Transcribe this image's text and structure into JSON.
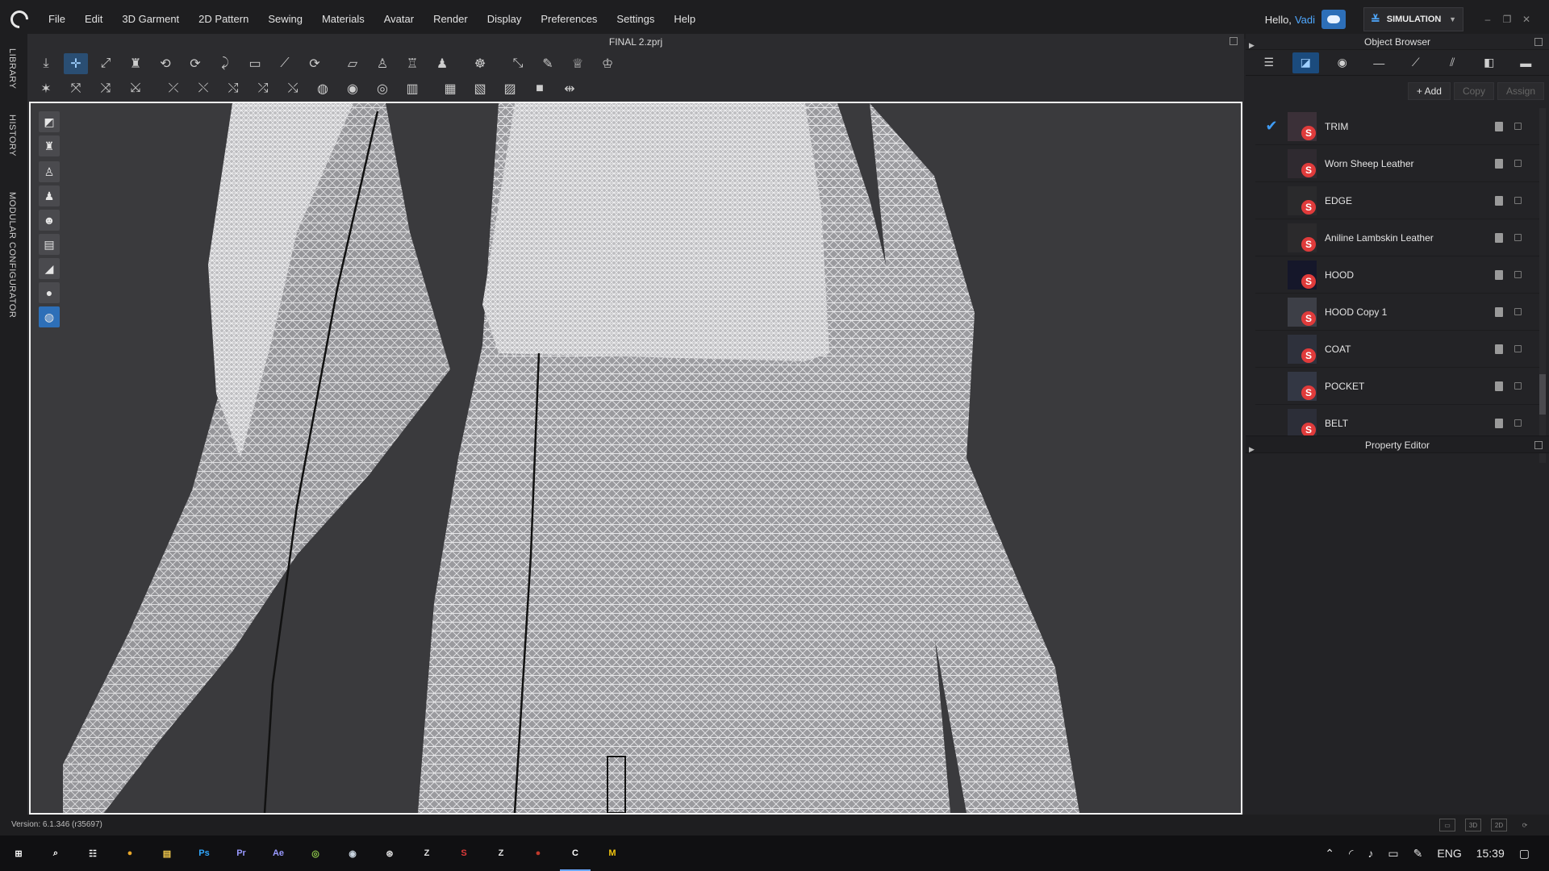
{
  "menu": [
    "File",
    "Edit",
    "3D Garment",
    "2D Pattern",
    "Sewing",
    "Materials",
    "Avatar",
    "Render",
    "Display",
    "Preferences",
    "Settings",
    "Help"
  ],
  "greeting": "Hello,",
  "username": "Vadi",
  "mode": "SIMULATION",
  "left_tabs": [
    "LIBRARY",
    "HISTORY",
    "MODULAR CONFIGURATOR"
  ],
  "file_title": "FINAL 2.zprj",
  "object_browser": {
    "title": "Object Browser",
    "actions": {
      "add": "+ Add",
      "copy": "Copy",
      "assign": "Assign"
    },
    "materials": [
      {
        "name": "TRIM",
        "selected": true,
        "thumb": "#3b3038"
      },
      {
        "name": "Worn Sheep Leather",
        "selected": false,
        "thumb": "#2f2a30"
      },
      {
        "name": "EDGE",
        "selected": false,
        "thumb": "#2a2a2c"
      },
      {
        "name": "Aniline Lambskin Leather",
        "selected": false,
        "thumb": "#2b2a2c"
      },
      {
        "name": "HOOD",
        "selected": false,
        "thumb": "#15172a"
      },
      {
        "name": "HOOD Copy 1",
        "selected": false,
        "thumb": "#3d3f47"
      },
      {
        "name": "COAT",
        "selected": false,
        "thumb": "#2e313c"
      },
      {
        "name": "POCKET",
        "selected": false,
        "thumb": "#333744"
      },
      {
        "name": "BELT",
        "selected": false,
        "thumb": "#2c2e38"
      }
    ]
  },
  "property_editor": {
    "title": "Property Editor"
  },
  "status": {
    "version": "Version: 6.1.346 (r35697)"
  },
  "taskbar": {
    "apps": [
      {
        "label": "⊞",
        "color": "#ffffff"
      },
      {
        "label": "⌕",
        "color": "#ffffff"
      },
      {
        "label": "☷",
        "color": "#ffffff"
      },
      {
        "label": "●",
        "color": "#e8a72a"
      },
      {
        "label": "▤",
        "color": "#f2c94c"
      },
      {
        "label": "Ps",
        "color": "#31a8ff"
      },
      {
        "label": "Pr",
        "color": "#9999ff"
      },
      {
        "label": "Ae",
        "color": "#9999ff"
      },
      {
        "label": "◎",
        "color": "#8bc34a"
      },
      {
        "label": "◉",
        "color": "#c9d4e0"
      },
      {
        "label": "⊛",
        "color": "#e0e0e0"
      },
      {
        "label": "Z",
        "color": "#e0e0e0"
      },
      {
        "label": "S",
        "color": "#e03b3b"
      },
      {
        "label": "Z",
        "color": "#e0e0e0"
      },
      {
        "label": "●",
        "color": "#c0392b"
      },
      {
        "label": "C",
        "color": "#ffffff"
      },
      {
        "label": "M",
        "color": "#f1c40f"
      }
    ],
    "language": "ENG",
    "time": "15:39"
  }
}
